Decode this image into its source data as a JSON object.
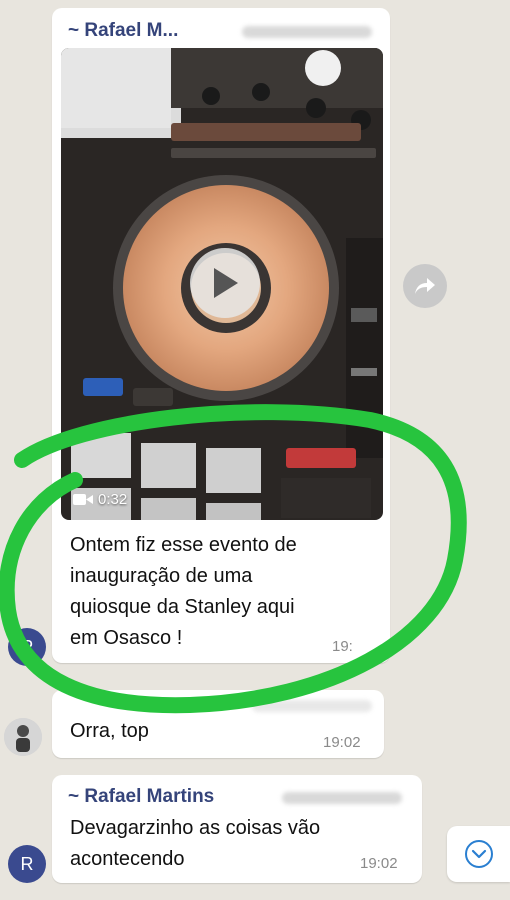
{
  "messages": [
    {
      "sender": "~ Rafael M...",
      "video_duration": "0:32",
      "text_lines": [
        "Ontem fiz esse evento de",
        "inauguração de uma",
        "quiosque da Stanley aqui",
        "em Osasco !"
      ],
      "time": "19:"
    },
    {
      "text": "Orra, top",
      "time": "19:02"
    },
    {
      "sender": "~ Rafael Martins",
      "text_lines": [
        "Devagarzinho as coisas vão",
        "acontecendo"
      ],
      "time": "19:02"
    }
  ],
  "avatars": {
    "initial": "R"
  },
  "icons": {
    "play": "play-icon",
    "camera": "video-camera-icon",
    "forward": "forward-icon",
    "scroll": "chevron-down-icon"
  },
  "colors": {
    "sender_name": "#35447a",
    "annotation_ring": "#27c43e",
    "avatar": "#3a4a8f",
    "chat_bg": "#e8e5de",
    "scroll_icon": "#2a7fd1"
  }
}
